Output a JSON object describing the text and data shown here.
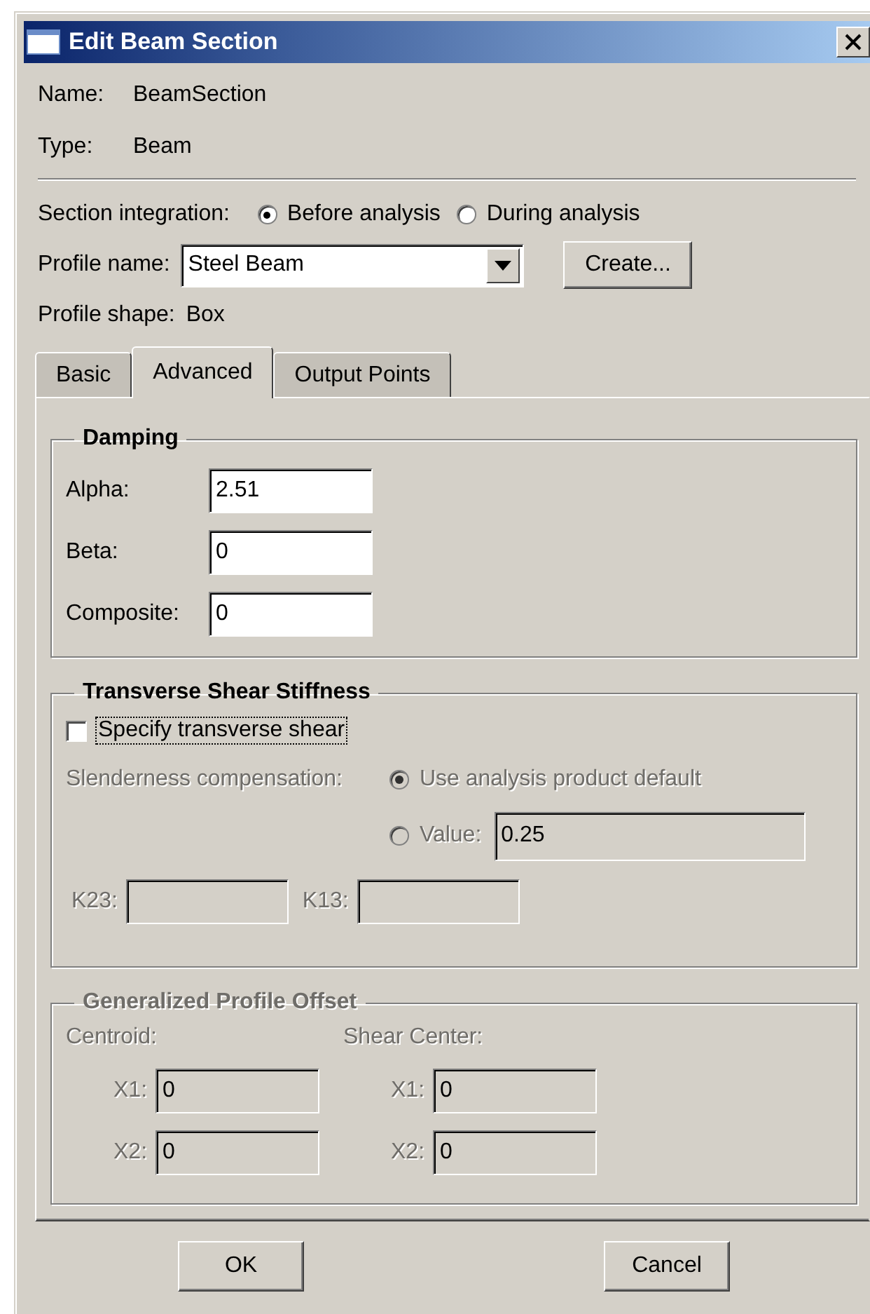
{
  "window": {
    "title": "Edit Beam Section"
  },
  "info": [
    {
      "label": "Name:",
      "value": "BeamSection"
    },
    {
      "label": "Type:",
      "value": "Beam"
    }
  ],
  "section_integration": {
    "label": "Section integration:",
    "options": [
      {
        "label": "Before analysis",
        "selected": true
      },
      {
        "label": "During analysis",
        "selected": false
      }
    ]
  },
  "profile_name": {
    "label": "Profile name:",
    "value": "Steel Beam",
    "button": "Create..."
  },
  "profile_shape": {
    "label": "Profile shape:",
    "value": "Box"
  },
  "tabs": [
    {
      "label": "Basic",
      "selected": false
    },
    {
      "label": "Advanced",
      "selected": true
    },
    {
      "label": "Output Points",
      "selected": false
    }
  ],
  "damping": {
    "title": "Damping",
    "fields": [
      {
        "label": "Alpha:",
        "value": "2.51"
      },
      {
        "label": "Beta:",
        "value": "0"
      },
      {
        "label": "Composite:",
        "value": "0"
      }
    ]
  },
  "transverse_shear": {
    "title": "Transverse Shear Stiffness",
    "checkbox": {
      "label": "Specify transverse shear",
      "checked": false,
      "focused": true
    },
    "slenderness": {
      "label": "Slenderness compensation:",
      "disabled": true,
      "options": [
        {
          "label": "Use analysis product default",
          "selected": true
        },
        {
          "label": "Value:",
          "selected": false,
          "value": "0.25"
        }
      ]
    },
    "k_fields": [
      {
        "label": "K23:",
        "disabled": true
      },
      {
        "label": "K13:",
        "disabled": true
      }
    ]
  },
  "profile_offset": {
    "title": "Generalized Profile Offset",
    "disabled": true,
    "columns": [
      {
        "heading": "Centroid:",
        "fields": [
          {
            "label": "X1:",
            "value": "0"
          },
          {
            "label": "X2:",
            "value": "0"
          }
        ]
      },
      {
        "heading": "Shear Center:",
        "fields": [
          {
            "label": "X1:",
            "value": "0"
          },
          {
            "label": "X2:",
            "value": "0"
          }
        ]
      }
    ]
  },
  "buttons": [
    "OK",
    "Cancel"
  ]
}
